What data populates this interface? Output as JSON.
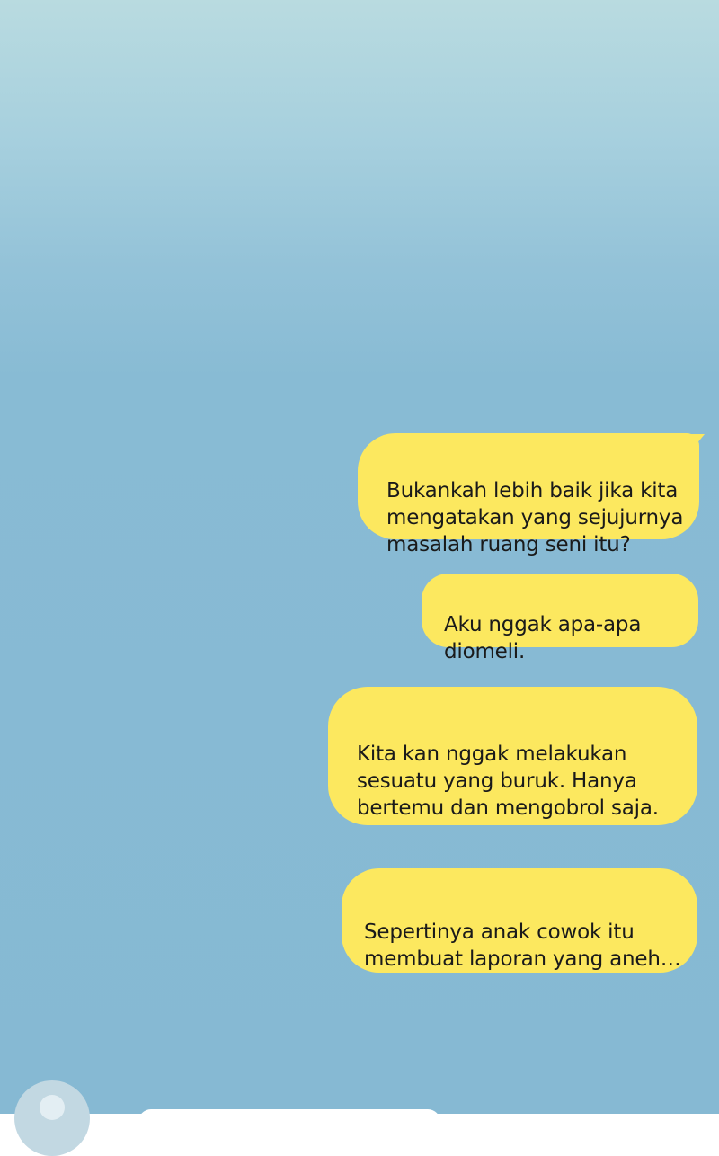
{
  "conversation": {
    "messages": [
      {
        "sender": "me",
        "text": "Bukankah lebih baik jika kita\nmengatakan yang sejujurnya\nmasalah ruang seni itu?"
      },
      {
        "sender": "me",
        "text": "Aku nggak apa-apa\ndiomeli."
      },
      {
        "sender": "me",
        "text": "Kita kan nggak melakukan\nsesuatu yang buruk. Hanya\nbertemu dan mengobrol saja."
      },
      {
        "sender": "me",
        "text": "Sepertinya anak cowok itu\nmembuat laporan yang aneh…"
      }
    ],
    "incoming_preview": {
      "avatar_icon": "user-avatar-icon"
    }
  },
  "colors": {
    "background_top": "#b9dbe0",
    "background_bottom": "#86b9d3",
    "outgoing_bubble": "#fce85f",
    "incoming_bubble": "#ffffff",
    "text": "#1a1a1a"
  }
}
